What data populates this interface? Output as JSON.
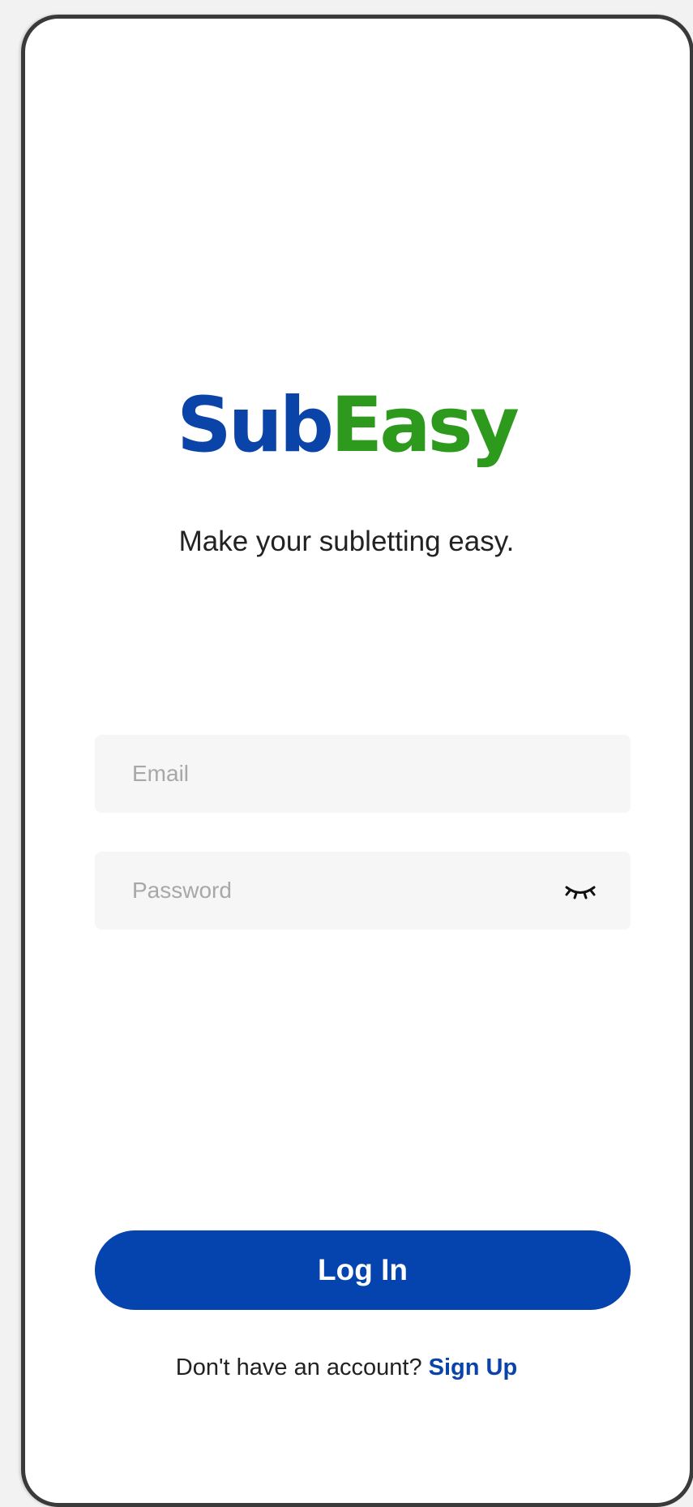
{
  "app": {
    "logo_part1": "Sub",
    "logo_part2": "Easy",
    "tagline": "Make your subletting easy."
  },
  "form": {
    "email": {
      "placeholder": "Email",
      "value": ""
    },
    "password": {
      "placeholder": "Password",
      "value": "",
      "toggle_icon": "eye-closed-icon"
    }
  },
  "actions": {
    "login_label": "Log In",
    "signup_prompt": "Don't have an account?",
    "signup_label": "Sign Up"
  },
  "colors": {
    "brand_blue": "#0b44a8",
    "brand_green": "#2d9a1e",
    "button_blue": "#0544ae",
    "field_background": "#f6f6f6"
  }
}
